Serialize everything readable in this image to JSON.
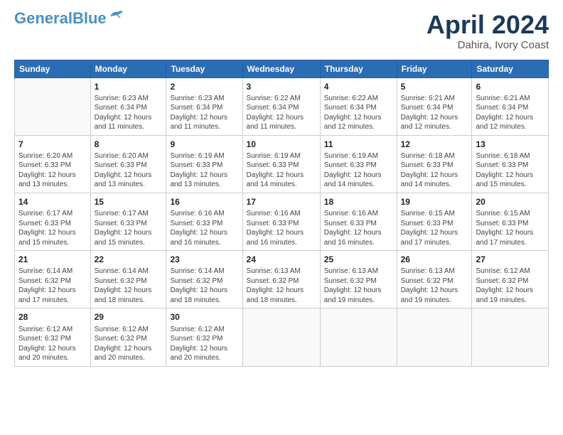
{
  "logo": {
    "line1": "General",
    "line2": "Blue"
  },
  "title": {
    "month": "April 2024",
    "location": "Dahira, Ivory Coast"
  },
  "calendar": {
    "headers": [
      "Sunday",
      "Monday",
      "Tuesday",
      "Wednesday",
      "Thursday",
      "Friday",
      "Saturday"
    ],
    "weeks": [
      [
        {
          "day": "",
          "info": ""
        },
        {
          "day": "1",
          "info": "Sunrise: 6:23 AM\nSunset: 6:34 PM\nDaylight: 12 hours\nand 11 minutes."
        },
        {
          "day": "2",
          "info": "Sunrise: 6:23 AM\nSunset: 6:34 PM\nDaylight: 12 hours\nand 11 minutes."
        },
        {
          "day": "3",
          "info": "Sunrise: 6:22 AM\nSunset: 6:34 PM\nDaylight: 12 hours\nand 11 minutes."
        },
        {
          "day": "4",
          "info": "Sunrise: 6:22 AM\nSunset: 6:34 PM\nDaylight: 12 hours\nand 12 minutes."
        },
        {
          "day": "5",
          "info": "Sunrise: 6:21 AM\nSunset: 6:34 PM\nDaylight: 12 hours\nand 12 minutes."
        },
        {
          "day": "6",
          "info": "Sunrise: 6:21 AM\nSunset: 6:34 PM\nDaylight: 12 hours\nand 12 minutes."
        }
      ],
      [
        {
          "day": "7",
          "info": "Sunrise: 6:20 AM\nSunset: 6:33 PM\nDaylight: 12 hours\nand 13 minutes."
        },
        {
          "day": "8",
          "info": "Sunrise: 6:20 AM\nSunset: 6:33 PM\nDaylight: 12 hours\nand 13 minutes."
        },
        {
          "day": "9",
          "info": "Sunrise: 6:19 AM\nSunset: 6:33 PM\nDaylight: 12 hours\nand 13 minutes."
        },
        {
          "day": "10",
          "info": "Sunrise: 6:19 AM\nSunset: 6:33 PM\nDaylight: 12 hours\nand 14 minutes."
        },
        {
          "day": "11",
          "info": "Sunrise: 6:19 AM\nSunset: 6:33 PM\nDaylight: 12 hours\nand 14 minutes."
        },
        {
          "day": "12",
          "info": "Sunrise: 6:18 AM\nSunset: 6:33 PM\nDaylight: 12 hours\nand 14 minutes."
        },
        {
          "day": "13",
          "info": "Sunrise: 6:18 AM\nSunset: 6:33 PM\nDaylight: 12 hours\nand 15 minutes."
        }
      ],
      [
        {
          "day": "14",
          "info": "Sunrise: 6:17 AM\nSunset: 6:33 PM\nDaylight: 12 hours\nand 15 minutes."
        },
        {
          "day": "15",
          "info": "Sunrise: 6:17 AM\nSunset: 6:33 PM\nDaylight: 12 hours\nand 15 minutes."
        },
        {
          "day": "16",
          "info": "Sunrise: 6:16 AM\nSunset: 6:33 PM\nDaylight: 12 hours\nand 16 minutes."
        },
        {
          "day": "17",
          "info": "Sunrise: 6:16 AM\nSunset: 6:33 PM\nDaylight: 12 hours\nand 16 minutes."
        },
        {
          "day": "18",
          "info": "Sunrise: 6:16 AM\nSunset: 6:33 PM\nDaylight: 12 hours\nand 16 minutes."
        },
        {
          "day": "19",
          "info": "Sunrise: 6:15 AM\nSunset: 6:33 PM\nDaylight: 12 hours\nand 17 minutes."
        },
        {
          "day": "20",
          "info": "Sunrise: 6:15 AM\nSunset: 6:33 PM\nDaylight: 12 hours\nand 17 minutes."
        }
      ],
      [
        {
          "day": "21",
          "info": "Sunrise: 6:14 AM\nSunset: 6:32 PM\nDaylight: 12 hours\nand 17 minutes."
        },
        {
          "day": "22",
          "info": "Sunrise: 6:14 AM\nSunset: 6:32 PM\nDaylight: 12 hours\nand 18 minutes."
        },
        {
          "day": "23",
          "info": "Sunrise: 6:14 AM\nSunset: 6:32 PM\nDaylight: 12 hours\nand 18 minutes."
        },
        {
          "day": "24",
          "info": "Sunrise: 6:13 AM\nSunset: 6:32 PM\nDaylight: 12 hours\nand 18 minutes."
        },
        {
          "day": "25",
          "info": "Sunrise: 6:13 AM\nSunset: 6:32 PM\nDaylight: 12 hours\nand 19 minutes."
        },
        {
          "day": "26",
          "info": "Sunrise: 6:13 AM\nSunset: 6:32 PM\nDaylight: 12 hours\nand 19 minutes."
        },
        {
          "day": "27",
          "info": "Sunrise: 6:12 AM\nSunset: 6:32 PM\nDaylight: 12 hours\nand 19 minutes."
        }
      ],
      [
        {
          "day": "28",
          "info": "Sunrise: 6:12 AM\nSunset: 6:32 PM\nDaylight: 12 hours\nand 20 minutes."
        },
        {
          "day": "29",
          "info": "Sunrise: 6:12 AM\nSunset: 6:32 PM\nDaylight: 12 hours\nand 20 minutes."
        },
        {
          "day": "30",
          "info": "Sunrise: 6:12 AM\nSunset: 6:32 PM\nDaylight: 12 hours\nand 20 minutes."
        },
        {
          "day": "",
          "info": ""
        },
        {
          "day": "",
          "info": ""
        },
        {
          "day": "",
          "info": ""
        },
        {
          "day": "",
          "info": ""
        }
      ]
    ]
  }
}
